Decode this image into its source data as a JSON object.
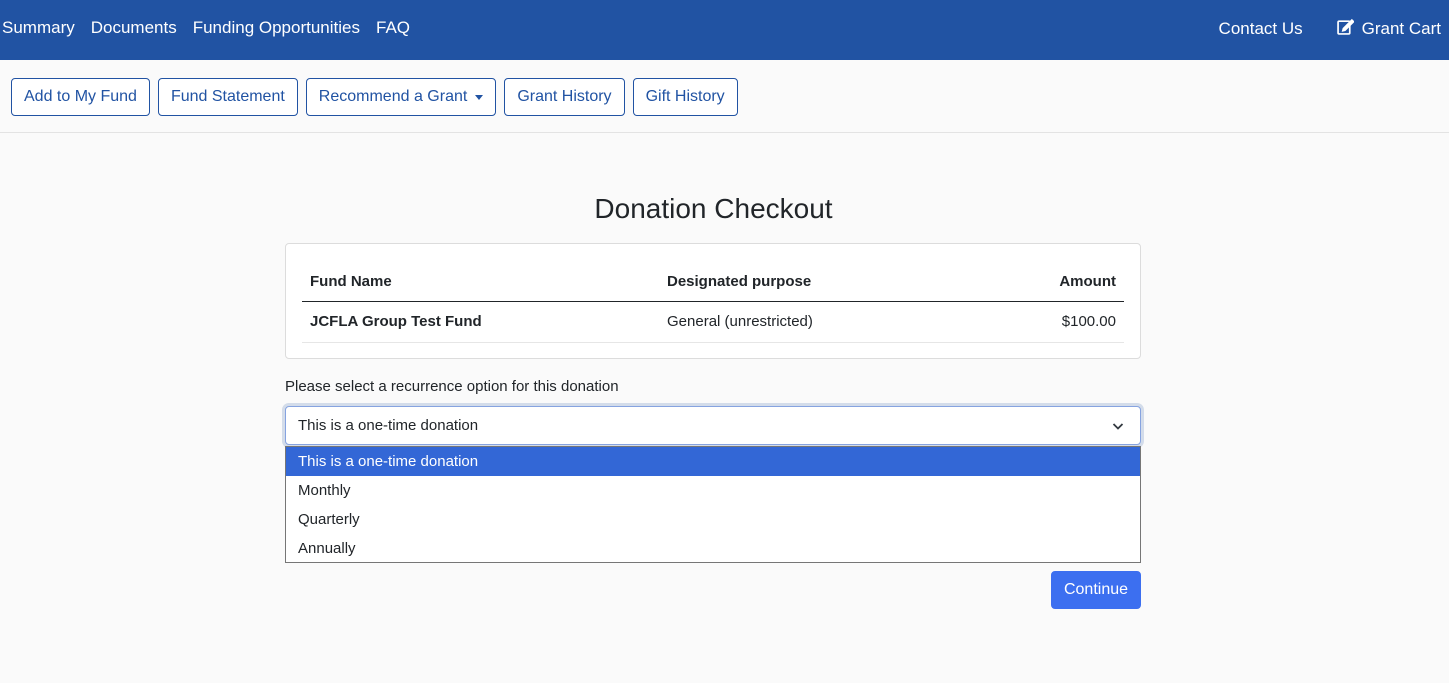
{
  "topnav": {
    "left_links": [
      "Summary",
      "Documents",
      "Funding Opportunities",
      "FAQ"
    ],
    "contact": "Contact Us",
    "cart": "Grant Cart",
    "cart_icon": "edit-icon"
  },
  "toolbar": {
    "add_fund": "Add to My Fund",
    "fund_statement": "Fund Statement",
    "recommend_grant": "Recommend a Grant",
    "grant_history": "Grant History",
    "gift_history": "Gift History"
  },
  "page": {
    "title": "Donation Checkout"
  },
  "table": {
    "headers": [
      "Fund Name",
      "Designated purpose",
      "Amount"
    ],
    "rows": [
      {
        "fund": "JCFLA Group Test Fund",
        "purpose": "General (unrestricted)",
        "amount": "$100.00"
      }
    ]
  },
  "recurrence": {
    "label": "Please select a recurrence option for this donation",
    "selected": "This is a one-time donation",
    "options": [
      "This is a one-time donation",
      "Monthly",
      "Quarterly",
      "Annually"
    ]
  },
  "actions": {
    "continue": "Continue"
  },
  "colors": {
    "nav_bg": "#2153a3",
    "primary": "#3c6ff0",
    "selected_option": "#3367d6"
  }
}
